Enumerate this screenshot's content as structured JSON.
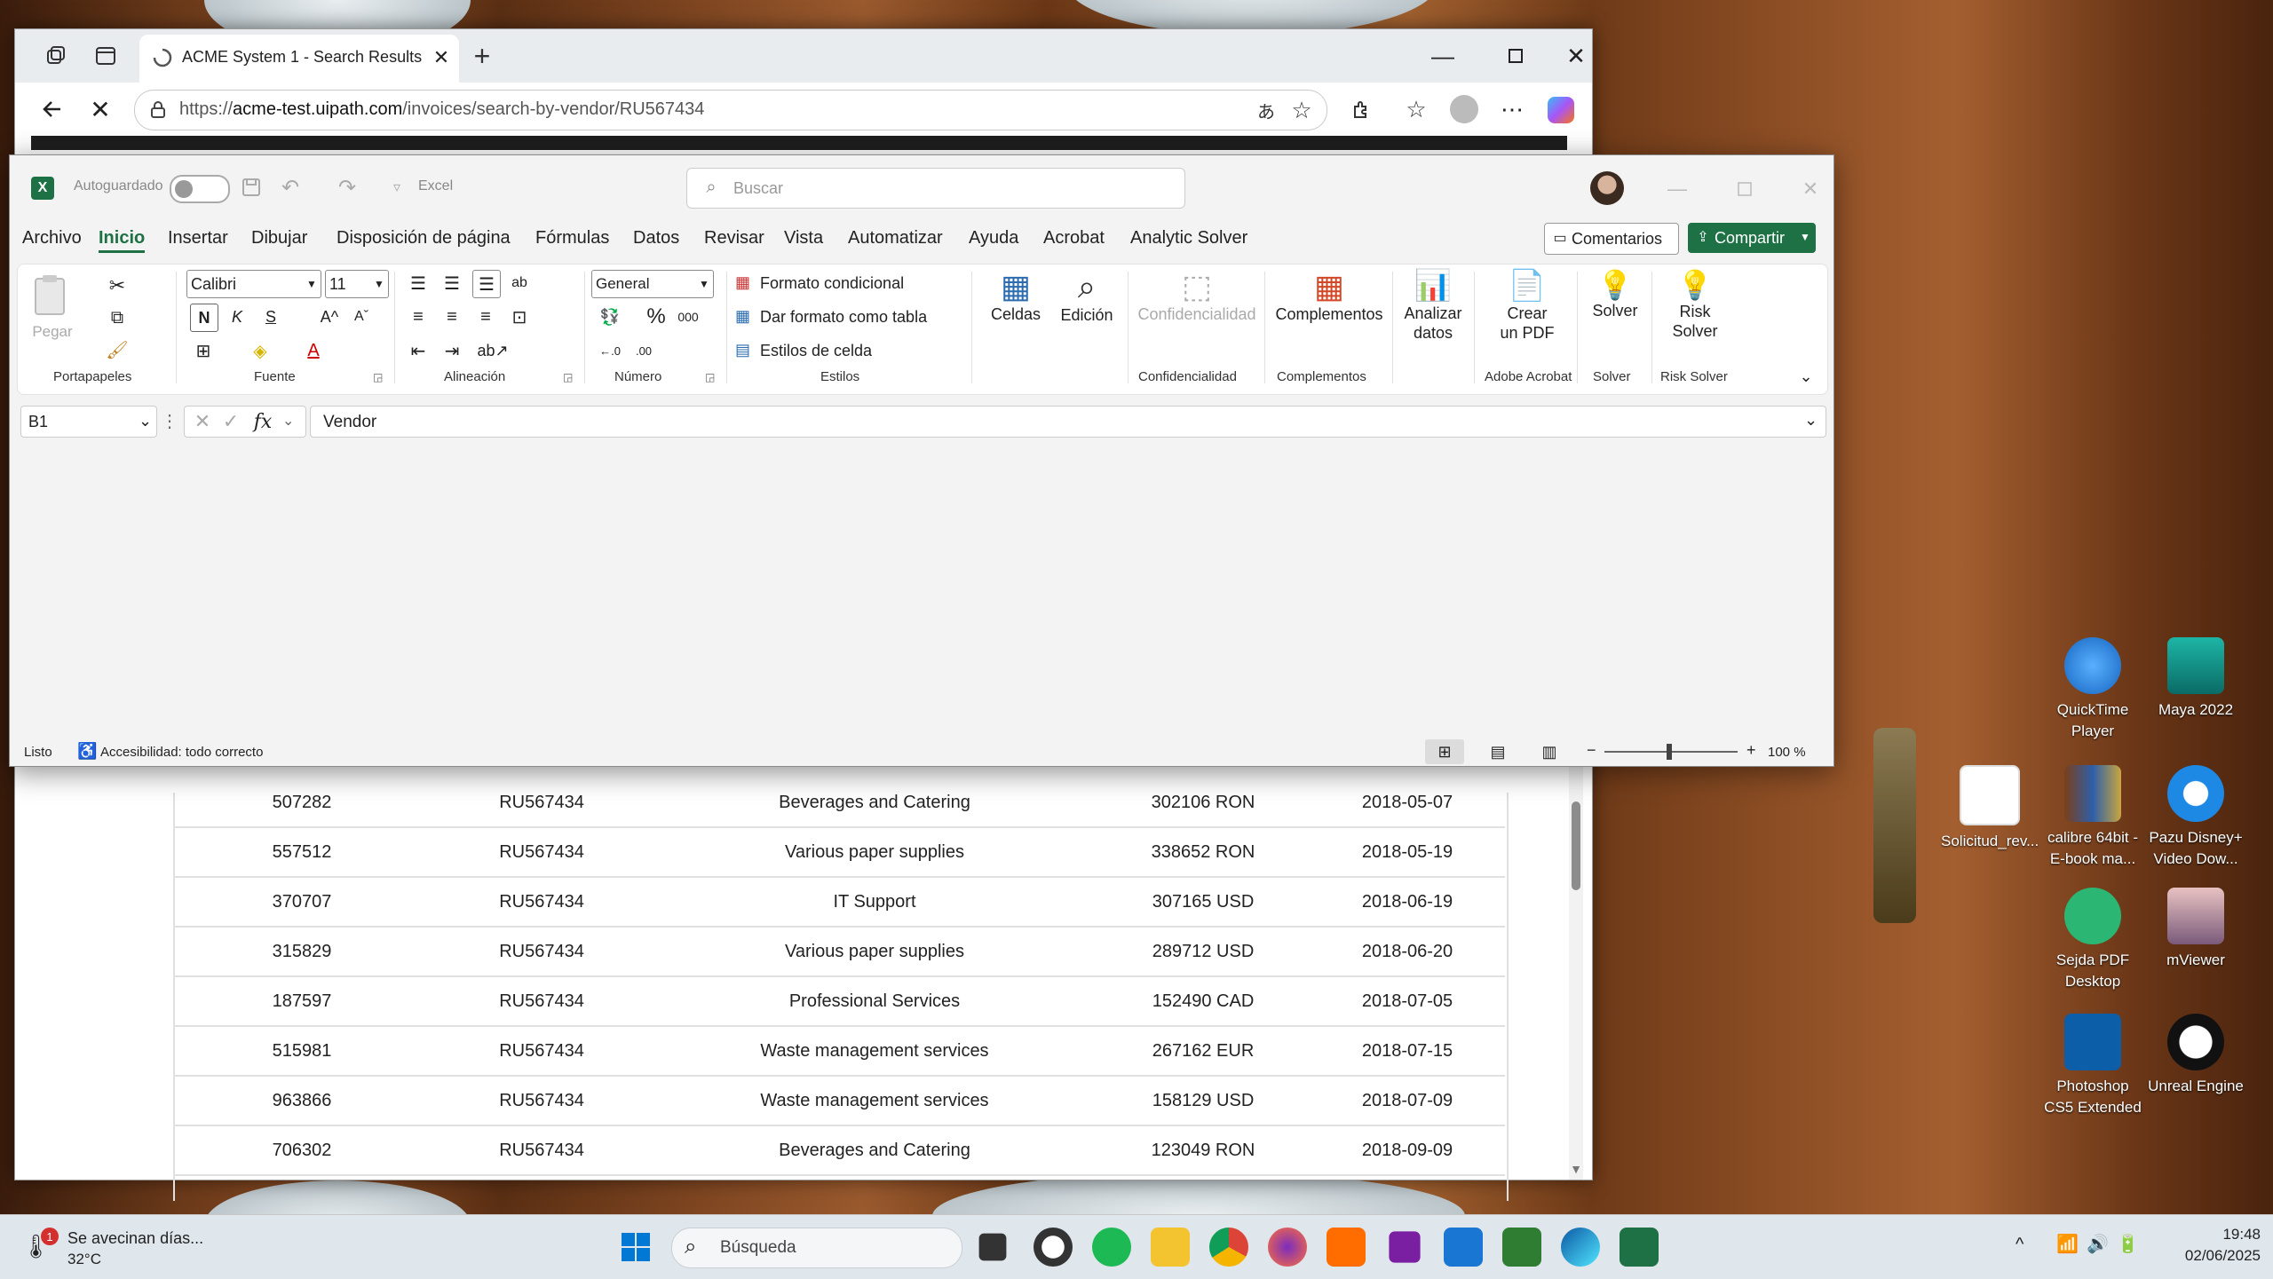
{
  "browser": {
    "tab_title": "ACME System 1 - Search Results",
    "url_prefix": "https://",
    "url_domain": "acme-test.uipath.com",
    "url_path": "/invoices/search-by-vendor/RU567434"
  },
  "table": {
    "rows": [
      {
        "invoice": "507282",
        "vendor": "RU567434",
        "description": "Beverages and Catering",
        "amount": "302106 RON",
        "date": "2018-05-07"
      },
      {
        "invoice": "557512",
        "vendor": "RU567434",
        "description": "Various paper supplies",
        "amount": "338652 RON",
        "date": "2018-05-19"
      },
      {
        "invoice": "370707",
        "vendor": "RU567434",
        "description": "IT Support",
        "amount": "307165 USD",
        "date": "2018-06-19"
      },
      {
        "invoice": "315829",
        "vendor": "RU567434",
        "description": "Various paper supplies",
        "amount": "289712 USD",
        "date": "2018-06-20"
      },
      {
        "invoice": "187597",
        "vendor": "RU567434",
        "description": "Professional Services",
        "amount": "152490 CAD",
        "date": "2018-07-05"
      },
      {
        "invoice": "515981",
        "vendor": "RU567434",
        "description": "Waste management services",
        "amount": "267162 EUR",
        "date": "2018-07-15"
      },
      {
        "invoice": "963866",
        "vendor": "RU567434",
        "description": "Waste management services",
        "amount": "158129 USD",
        "date": "2018-07-09"
      },
      {
        "invoice": "706302",
        "vendor": "RU567434",
        "description": "Beverages and Catering",
        "amount": "123049 RON",
        "date": "2018-09-09"
      }
    ]
  },
  "excel": {
    "autosave_label": "Autoguardado",
    "app_name": "Excel",
    "search_placeholder": "Buscar",
    "menu": [
      "Archivo",
      "Inicio",
      "Insertar",
      "Dibujar",
      "Disposición de página",
      "Fórmulas",
      "Datos",
      "Revisar",
      "Vista",
      "Automatizar",
      "Ayuda",
      "Acrobat",
      "Analytic Solver"
    ],
    "comments_label": "Comentarios",
    "share_label": "Compartir",
    "ribbon": {
      "paste_label": "Pegar",
      "clipboard_group": "Portapapeles",
      "font_name": "Calibri",
      "font_size": "11",
      "bold": "N",
      "italic": "K",
      "underline": "S",
      "font_group": "Fuente",
      "alignment_group": "Alineación",
      "number_format": "General",
      "number_group": "Número",
      "conditional_format": "Formato condicional",
      "format_as_table": "Dar formato como tabla",
      "cell_styles": "Estilos de celda",
      "styles_group": "Estilos",
      "cells_label": "Celdas",
      "editing_label": "Edición",
      "sensitivity_label": "Confidencialidad",
      "sensitivity_group": "Confidencialidad",
      "addins_label": "Complementos",
      "addins_group": "Complementos",
      "analyze_label_1": "Analizar",
      "analyze_label_2": "datos",
      "create_pdf_1": "Crear",
      "create_pdf_2": "un PDF",
      "acrobat_group": "Adobe Acrobat",
      "solver_label": "Solver",
      "solver_group": "Solver",
      "risk_solver_1": "Risk",
      "risk_solver_2": "Solver",
      "risk_solver_group": "Risk Solver"
    },
    "name_box": "B1",
    "formula_value": "Vendor",
    "status_ready": "Listo",
    "accessibility": "Accesibilidad: todo correcto",
    "zoom": "100 %"
  },
  "desktop": {
    "icons": [
      {
        "label": "QuickTime Player"
      },
      {
        "label": "Maya 2022"
      },
      {
        "label": "Solicitud_rev..."
      },
      {
        "label": "calibre 64bit - E-book ma..."
      },
      {
        "label": "Pazu Disney+ Video Dow..."
      },
      {
        "label": "Sejda PDF Desktop"
      },
      {
        "label": "mViewer"
      },
      {
        "label": "Photoshop CS5 Extended"
      },
      {
        "label": "Unreal Engine"
      }
    ]
  },
  "taskbar": {
    "weather_text": "Se avecinan días...",
    "weather_temp": "32°C",
    "weather_badge": "1",
    "search_placeholder": "Búsqueda",
    "time": "19:48",
    "date": "02/06/2025"
  },
  "colors": {
    "excel_green": "#1e7145",
    "edge_blue": "#0078d4"
  }
}
